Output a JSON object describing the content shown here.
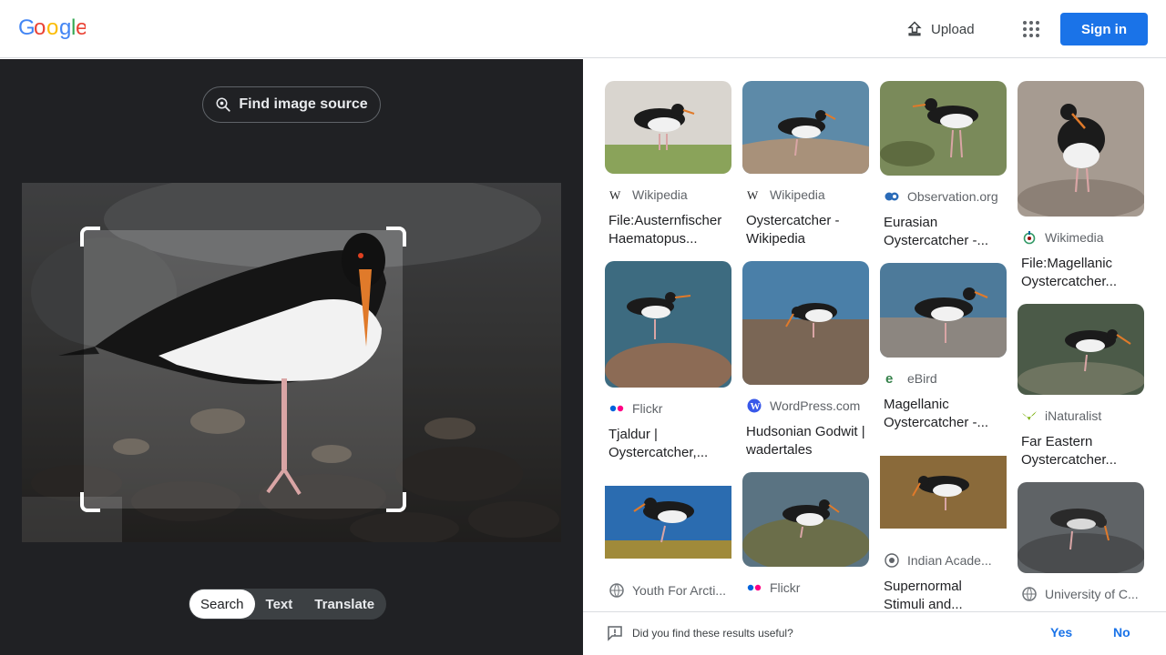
{
  "header": {
    "logo_text": "Google",
    "upload_label": "Upload",
    "signin_label": "Sign in"
  },
  "left": {
    "find_source_label": "Find image source",
    "tabs": [
      "Search",
      "Text",
      "Translate"
    ],
    "active_tab": "Search"
  },
  "results": {
    "col1": [
      {
        "source": "Wikipedia",
        "icon": "wikipedia-icon",
        "title": "File:Austernfischer Haematopus..."
      },
      {
        "source": "Flickr",
        "icon": "flickr-icon",
        "title": "Tjaldur | Oystercatcher,..."
      },
      {
        "source": "Youth For Arcti...",
        "icon": "globe-icon",
        "title": ""
      }
    ],
    "col2": [
      {
        "source": "Wikipedia",
        "icon": "wikipedia-icon",
        "title": "Oystercatcher - Wikipedia"
      },
      {
        "source": "WordPress.com",
        "icon": "wordpress-icon",
        "title": "Hudsonian Godwit | wadertales"
      },
      {
        "source": "Flickr",
        "icon": "flickr-icon",
        "title": ""
      }
    ],
    "col3": [
      {
        "source": "Observation.org",
        "icon": "observation-icon",
        "title": "Eurasian Oystercatcher -..."
      },
      {
        "source": "eBird",
        "icon": "ebird-icon",
        "title": "Magellanic Oystercatcher -..."
      },
      {
        "source": "Indian Acade...",
        "icon": "seal-icon",
        "title": "Supernormal Stimuli and..."
      }
    ],
    "col4": [
      {
        "source": "Wikimedia",
        "icon": "wikimedia-icon",
        "title": "File:Magellanic Oystercatcher..."
      },
      {
        "source": "iNaturalist",
        "icon": "inaturalist-icon",
        "title": "Far Eastern Oystercatcher..."
      },
      {
        "source": "University of C...",
        "icon": "globe-icon",
        "title": ""
      }
    ]
  },
  "feedback": {
    "question": "Did you find these results useful?",
    "yes": "Yes",
    "no": "No"
  },
  "colors": {
    "accent": "#1a73e8",
    "dark_panel": "#202124"
  }
}
